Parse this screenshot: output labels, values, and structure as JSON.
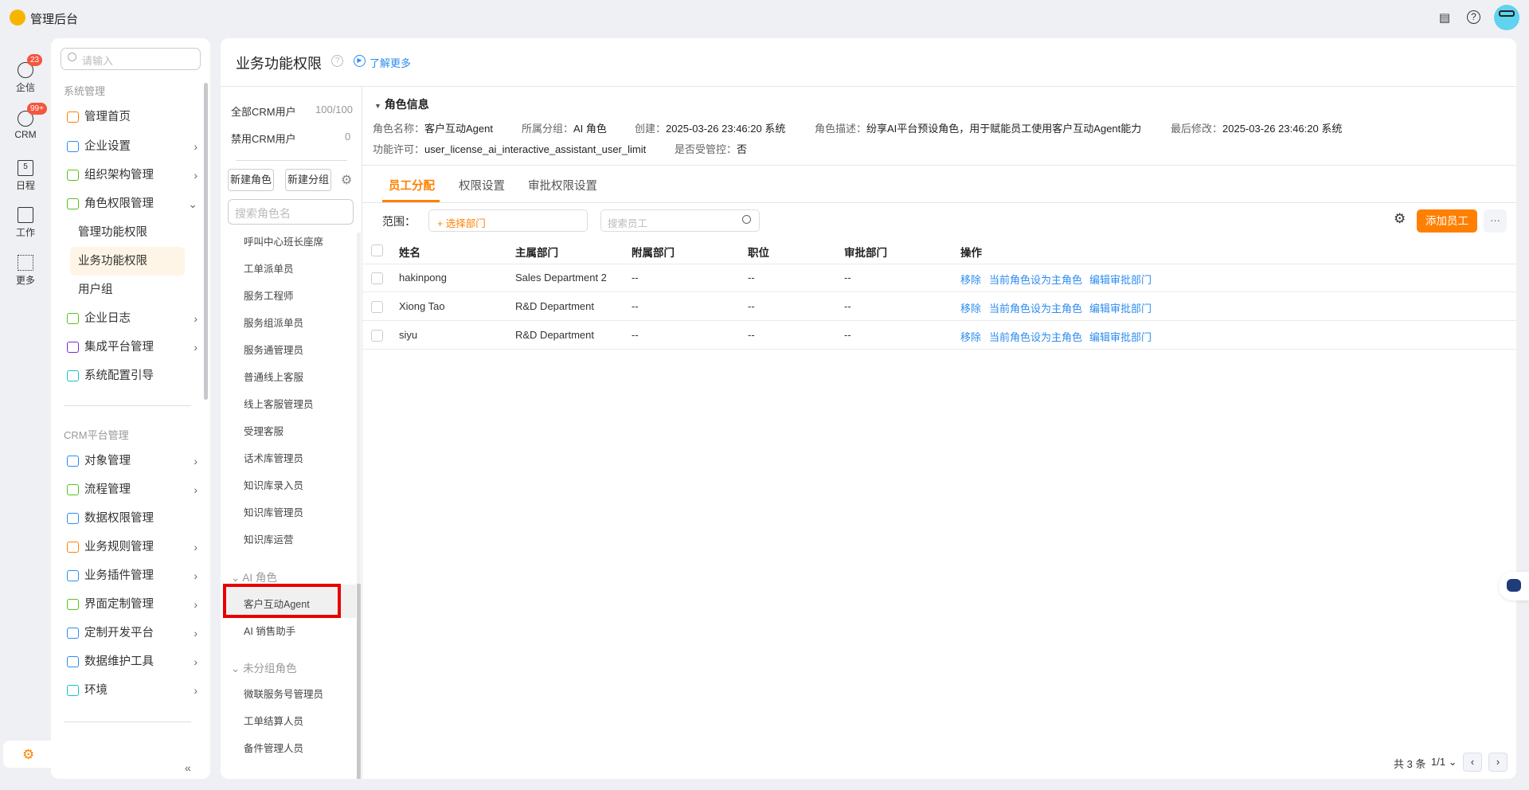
{
  "app": {
    "title": "管理后台"
  },
  "rail": [
    {
      "label": "企信",
      "badge": "23"
    },
    {
      "label": "CRM",
      "badge": "99+"
    },
    {
      "label": "日程",
      "day": "5"
    },
    {
      "label": "工作"
    },
    {
      "label": "更多"
    }
  ],
  "sidebar": {
    "search_placeholder": "请输入",
    "sections": [
      {
        "title": "系统管理"
      },
      {
        "title": "CRM平台管理"
      }
    ],
    "items1": [
      "管理首页",
      "企业设置",
      "组织架构管理",
      "角色权限管理"
    ],
    "subitems": [
      "管理功能权限",
      "业务功能权限",
      "用户组"
    ],
    "items2": [
      "企业日志",
      "集成平台管理",
      "系统配置引导"
    ],
    "items3": [
      "对象管理",
      "流程管理",
      "数据权限管理",
      "业务规则管理",
      "业务插件管理",
      "界面定制管理",
      "定制开发平台",
      "数据维护工具",
      "环境"
    ]
  },
  "header": {
    "title": "业务功能权限",
    "learn_more": "了解更多"
  },
  "roles": {
    "all_users_label": "全部CRM用户",
    "all_users_count": "100/100",
    "disabled_label": "禁用CRM用户",
    "disabled_count": "0",
    "new_role": "新建角色",
    "new_group": "新建分组",
    "search_placeholder": "搜索角色名",
    "list": [
      "呼叫中心班长座席",
      "工单派单员",
      "服务工程师",
      "服务组派单员",
      "服务通管理员",
      "普通线上客服",
      "线上客服管理员",
      "受理客服",
      "话术库管理员",
      "知识库录入员",
      "知识库管理员",
      "知识库运营"
    ],
    "ai_group": "AI 角色",
    "ai_list": [
      "客户互动Agent",
      "AI 销售助手"
    ],
    "ungrouped": "未分组角色",
    "ungrouped_list": [
      "微联服务号管理员",
      "工单结算人员",
      "备件管理人员"
    ]
  },
  "role_info": {
    "title": "角色信息",
    "name_label": "角色名称：",
    "name": "客户互动Agent",
    "group_label": "所属分组：",
    "group": "AI 角色",
    "created_label": "创建：",
    "created": "2025-03-26 23:46:20 系统",
    "desc_label": "角色描述：",
    "desc": "纷享AI平台预设角色，用于赋能员工使用客户互动Agent能力",
    "modified_label": "最后修改：",
    "modified": "2025-03-26 23:46:20 系统",
    "license_label": "功能许可：",
    "license": "user_license_ai_interactive_assistant_user_limit",
    "controlled_label": "是否受管控：",
    "controlled": "否"
  },
  "tabs": [
    "员工分配",
    "权限设置",
    "审批权限设置"
  ],
  "toolbar": {
    "scope_label": "范围：",
    "dept_placeholder": "+ 选择部门",
    "search_placeholder": "搜索员工",
    "add_button": "添加员工",
    "more": "···"
  },
  "table": {
    "headers": [
      "姓名",
      "主属部门",
      "附属部门",
      "职位",
      "审批部门",
      "操作"
    ],
    "rows": [
      {
        "name": "hakinpong",
        "dept": "Sales Department 2",
        "sub": "--",
        "pos": "--",
        "approve": "--"
      },
      {
        "name": "Xiong Tao",
        "dept": "R&D Department",
        "sub": "--",
        "pos": "--",
        "approve": "--"
      },
      {
        "name": "siyu",
        "dept": "R&D Department",
        "sub": "--",
        "pos": "--",
        "approve": "--"
      }
    ],
    "actions": [
      "移除",
      "当前角色设为主角色",
      "编辑审批部门"
    ]
  },
  "pagination": {
    "total": "共 3 条",
    "page": "1/1"
  },
  "colors": {
    "accent": "#ff8000",
    "link": "#2d8cf0",
    "highlight": "#e60000"
  }
}
